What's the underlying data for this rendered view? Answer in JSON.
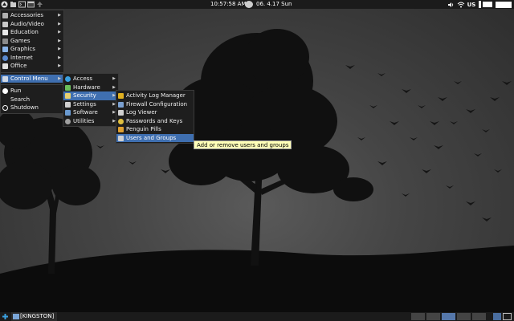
{
  "top_panel": {
    "clock": "10:57:58 AM",
    "date": "06. 4.17 Sun",
    "keyboard_layout": "US",
    "icons": [
      "menu-logo-icon",
      "file-manager-icon",
      "terminal-icon",
      "browser-icon",
      "update-icon"
    ]
  },
  "main_menu": {
    "items": [
      {
        "label": "Accessories",
        "icon": "accessories-icon",
        "color": "#b0b0b0"
      },
      {
        "label": "Audio/Video",
        "icon": "audio-video-icon",
        "color": "#c8c8c8"
      },
      {
        "label": "Education",
        "icon": "education-icon",
        "color": "#e6e6e6"
      },
      {
        "label": "Games",
        "icon": "games-icon",
        "color": "#8a8a8a"
      },
      {
        "label": "Graphics",
        "icon": "graphics-icon",
        "color": "#8ab4e8"
      },
      {
        "label": "Internet",
        "icon": "internet-icon",
        "color": "#5a8ad0"
      },
      {
        "label": "Office",
        "icon": "office-icon",
        "color": "#e0e0e0"
      },
      {
        "label": "Control Menu",
        "icon": "control-menu-icon",
        "color": "#cfd8e6"
      },
      {
        "label": "Run",
        "icon": "run-icon",
        "color": "#ffffff"
      },
      {
        "label": "Search",
        "icon": "search-icon",
        "color": "#cccccc"
      },
      {
        "label": "Shutdown",
        "icon": "shutdown-icon",
        "color": "#ffffff"
      }
    ]
  },
  "control_menu": {
    "items": [
      {
        "label": "Access",
        "icon": "access-icon",
        "color": "#3aa0e0"
      },
      {
        "label": "Hardware",
        "icon": "hardware-icon",
        "color": "#6abf5a"
      },
      {
        "label": "Security",
        "icon": "security-icon",
        "color": "#e8d070"
      },
      {
        "label": "Settings",
        "icon": "settings-icon",
        "color": "#d0d0d0"
      },
      {
        "label": "Software",
        "icon": "software-icon",
        "color": "#6a9ad0"
      },
      {
        "label": "Utilities",
        "icon": "utilities-icon",
        "color": "#a0a0a0"
      }
    ]
  },
  "security_menu": {
    "items": [
      {
        "label": "Activity Log Manager",
        "icon": "lock-icon",
        "color": "#e0b020"
      },
      {
        "label": "Firewall Configuration",
        "icon": "firewall-icon",
        "color": "#7aa0d0"
      },
      {
        "label": "Log Viewer",
        "icon": "log-viewer-icon",
        "color": "#d0d0d0"
      },
      {
        "label": "Passwords and Keys",
        "icon": "key-icon",
        "color": "#e0c040"
      },
      {
        "label": "Penguin Pills",
        "icon": "penguin-icon",
        "color": "#e0a030"
      },
      {
        "label": "Users and Groups",
        "icon": "users-icon",
        "color": "#d0d0d0"
      }
    ]
  },
  "tooltip": "Add or remove users and groups",
  "bottom_panel": {
    "task": "[KINGSTON]"
  },
  "colors": {
    "selection": "#3f6fb0",
    "panel": "#1b1b1b",
    "menu_bg": "#1e1e1e",
    "tooltip_bg": "#ffffb8"
  }
}
